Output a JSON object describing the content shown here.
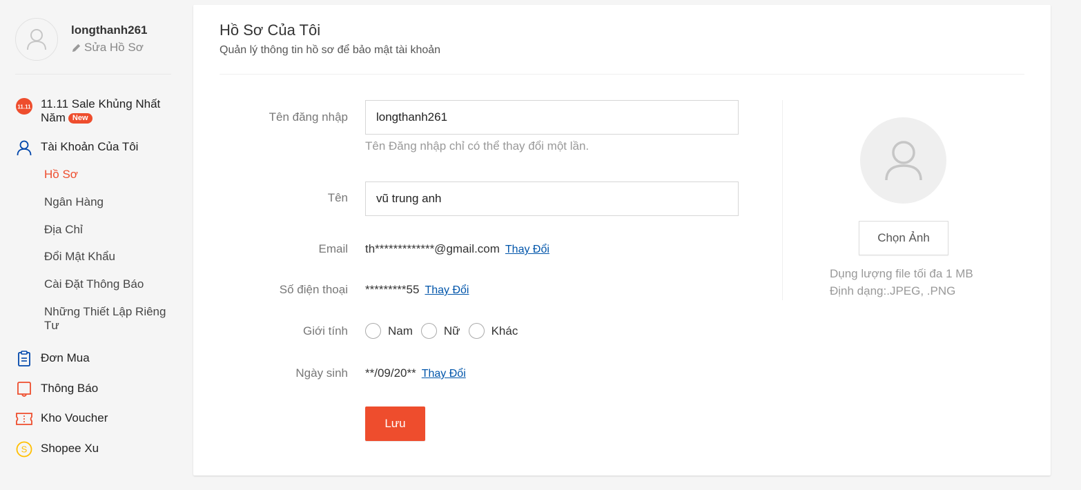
{
  "user": {
    "username": "longthanh261",
    "edit_label": "Sửa Hồ Sơ"
  },
  "nav": {
    "sale": {
      "label": "11.11 Sale Khủng Nhất Năm",
      "badge": "New",
      "icon_text": "11.11"
    },
    "account": {
      "label": "Tài Khoản Của Tôi"
    },
    "sub_items": [
      {
        "label": "Hồ Sơ",
        "active": true
      },
      {
        "label": "Ngân Hàng"
      },
      {
        "label": "Địa Chỉ"
      },
      {
        "label": "Đổi Mật Khẩu"
      },
      {
        "label": "Cài Đặt Thông Báo"
      },
      {
        "label": "Những Thiết Lập Riêng Tư"
      }
    ],
    "orders": {
      "label": "Đơn Mua"
    },
    "notifications": {
      "label": "Thông Báo"
    },
    "vouchers": {
      "label": "Kho Voucher"
    },
    "coins": {
      "label": "Shopee Xu",
      "icon_text": "S"
    }
  },
  "profile": {
    "title": "Hồ Sơ Của Tôi",
    "subtitle": "Quản lý thông tin hồ sơ để bảo mật tài khoản",
    "username_label": "Tên đăng nhập",
    "username_value": "longthanh261",
    "username_hint": "Tên Đăng nhập chỉ có thể thay đổi một lần.",
    "name_label": "Tên",
    "name_value": "vũ trung anh",
    "email_label": "Email",
    "email_value": "th*************@gmail.com",
    "phone_label": "Số điện thoại",
    "phone_value": "*********55",
    "change_label": "Thay Đổi",
    "gender_label": "Giới tính",
    "gender_options": [
      "Nam",
      "Nữ",
      "Khác"
    ],
    "birthday_label": "Ngày sinh",
    "birthday_value": "**/09/20**",
    "save_label": "Lưu"
  },
  "avatar_panel": {
    "choose_label": "Chọn Ảnh",
    "size_note": "Dụng lượng file tối đa 1 MB",
    "format_note": "Định dạng:.JPEG, .PNG"
  },
  "colors": {
    "accent": "#ee4d2d",
    "link": "#0055aa",
    "account_icon": "#0046ab",
    "coin_icon": "#ffbf00"
  }
}
